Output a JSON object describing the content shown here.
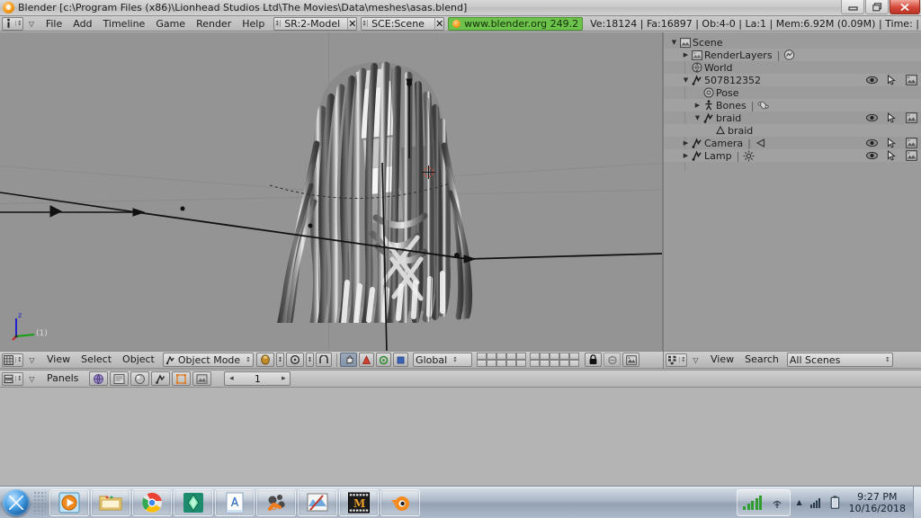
{
  "window": {
    "title": "Blender [c:\\Program Files (x86)\\Lionhead Studios Ltd\\The Movies\\Data\\meshes\\asas.blend]",
    "app_icon": "blender-icon",
    "minimize_label": "–",
    "maximize_label": "❐",
    "close_label": "✕"
  },
  "blender_header": {
    "window_type_icon": "info-editor-icon",
    "menu_arrow": "▽",
    "menus": [
      "File",
      "Add",
      "Timeline",
      "Game",
      "Render",
      "Help"
    ],
    "screen_selector": {
      "value": "SR:2-Model",
      "delete_label": "✕"
    },
    "scene_selector": {
      "value": "SCE:Scene",
      "delete_label": "✕"
    },
    "version_link": "www.blender.org 249.2",
    "stats": "Ve:18124 | Fa:16897 | Ob:4-0 | La:1  | Mem:6.92M (0.09M)  | Time: |"
  },
  "viewport": {
    "gizmo": {
      "z_label": "z",
      "y_label": "y",
      "x_label": "x",
      "layer_count": "(1)"
    }
  },
  "viewport_header": {
    "editor_icon": "3d-view-icon",
    "menu_arrow": "▽",
    "menus": [
      "View",
      "Select",
      "Object"
    ],
    "mode_selector": {
      "icon": "object-mode-icon",
      "value": "Object Mode"
    },
    "draw_type": "solid-shading-icon",
    "pivot": "median-point-icon",
    "manipulator_widgets": [
      "translate-manipulator-icon",
      "rotate-manipulator-icon",
      "scale-manipulator-icon"
    ],
    "orientation_selector": {
      "value": "Global"
    },
    "layers_group1": 10,
    "layers_group2": 10,
    "lock_icon": "lock-icon",
    "render_icon": "render-preview-icon",
    "link_icon": "link-scene-icon"
  },
  "outliner_header": {
    "editor_icon": "outliner-icon",
    "menu_arrow": "▽",
    "menus": [
      "View",
      "Search"
    ],
    "scope_selector": {
      "value": "All Scenes"
    }
  },
  "outliner": {
    "rows": [
      {
        "indent": 0,
        "expander": "▼",
        "icon": "scene-icon",
        "name": "Scene",
        "extra": "",
        "extra_icon": "",
        "show_toggles": false
      },
      {
        "indent": 1,
        "expander": "▶",
        "icon": "renderlayer-icon",
        "name": "RenderLayers",
        "extra": "|",
        "extra_icon": "renderlayer-data-icon",
        "show_toggles": false
      },
      {
        "indent": 1,
        "expander": "",
        "icon": "world-icon",
        "name": "World",
        "extra": "",
        "extra_icon": "",
        "show_toggles": false
      },
      {
        "indent": 1,
        "expander": "▼",
        "icon": "armature-object-icon",
        "name": "507812352",
        "extra": "",
        "extra_icon": "",
        "show_toggles": true
      },
      {
        "indent": 2,
        "expander": "",
        "icon": "pose-icon",
        "name": "Pose",
        "extra": "",
        "extra_icon": "",
        "show_toggles": false
      },
      {
        "indent": 2,
        "expander": "▶",
        "icon": "bones-icon",
        "name": "Bones",
        "extra": "|",
        "extra_icon": "bone-data-icon",
        "show_toggles": false
      },
      {
        "indent": 2,
        "expander": "▼",
        "icon": "armature-object-icon",
        "name": "braid",
        "extra": "",
        "extra_icon": "",
        "show_toggles": true
      },
      {
        "indent": 3,
        "expander": "",
        "icon": "mesh-data-icon",
        "name": "braid",
        "extra": "",
        "extra_icon": "",
        "show_toggles": false
      },
      {
        "indent": 1,
        "expander": "▶",
        "icon": "armature-object-icon",
        "name": "Camera",
        "extra": "|",
        "extra_icon": "camera-data-icon",
        "show_toggles": true
      },
      {
        "indent": 1,
        "expander": "▶",
        "icon": "armature-object-icon",
        "name": "Lamp",
        "extra": "|",
        "extra_icon": "lamp-data-icon",
        "show_toggles": true
      }
    ],
    "toggle_icons": [
      "visibility-eye-icon",
      "selectable-cursor-icon",
      "renderable-icon"
    ]
  },
  "buttons_header": {
    "editor_icon": "buttons-window-icon",
    "menu_arrow": "▽",
    "menu_label": "Panels",
    "context_buttons": [
      {
        "name": "logic-context-icon",
        "active": false
      },
      {
        "name": "script-context-icon",
        "active": false
      },
      {
        "name": "shading-context-icon",
        "active": false
      },
      {
        "name": "object-context-icon",
        "active": false
      },
      {
        "name": "editing-context-icon",
        "active": true
      },
      {
        "name": "scene-context-icon",
        "active": false
      }
    ],
    "frame_field": {
      "prev": "◂",
      "value": "1",
      "next": "▸"
    }
  },
  "taskbar": {
    "start_label": "start-orb",
    "items": [
      {
        "icon": "windows-media-player-icon"
      },
      {
        "icon": "windows-explorer-icon"
      },
      {
        "icon": "google-chrome-icon"
      },
      {
        "icon": "sims-plumbob-icon"
      },
      {
        "icon": "notepad-document-icon"
      },
      {
        "icon": "sketchup-icon"
      },
      {
        "icon": "paint-image-icon"
      },
      {
        "icon": "the-movies-icon"
      },
      {
        "icon": "blender-icon"
      }
    ],
    "tray": {
      "signal_icon": "signal-bars-icon",
      "network_icon": "wireless-icon",
      "show_hidden_icon": "▲",
      "volume_icon": "volume-icon",
      "battery_icon": "battery-icon",
      "time": "9:27 PM",
      "date": "10/16/2018"
    }
  },
  "colors": {
    "viewport_bg": "#949494",
    "outliner_bg": "#9b9b9b",
    "header_bg": "#c2c2c2",
    "accent_green": "#6cc24a",
    "cursor_red": "#d94f3d",
    "axis_z": "#2222cc",
    "axis_y": "#11a011",
    "axis_x": "#cc2222"
  }
}
